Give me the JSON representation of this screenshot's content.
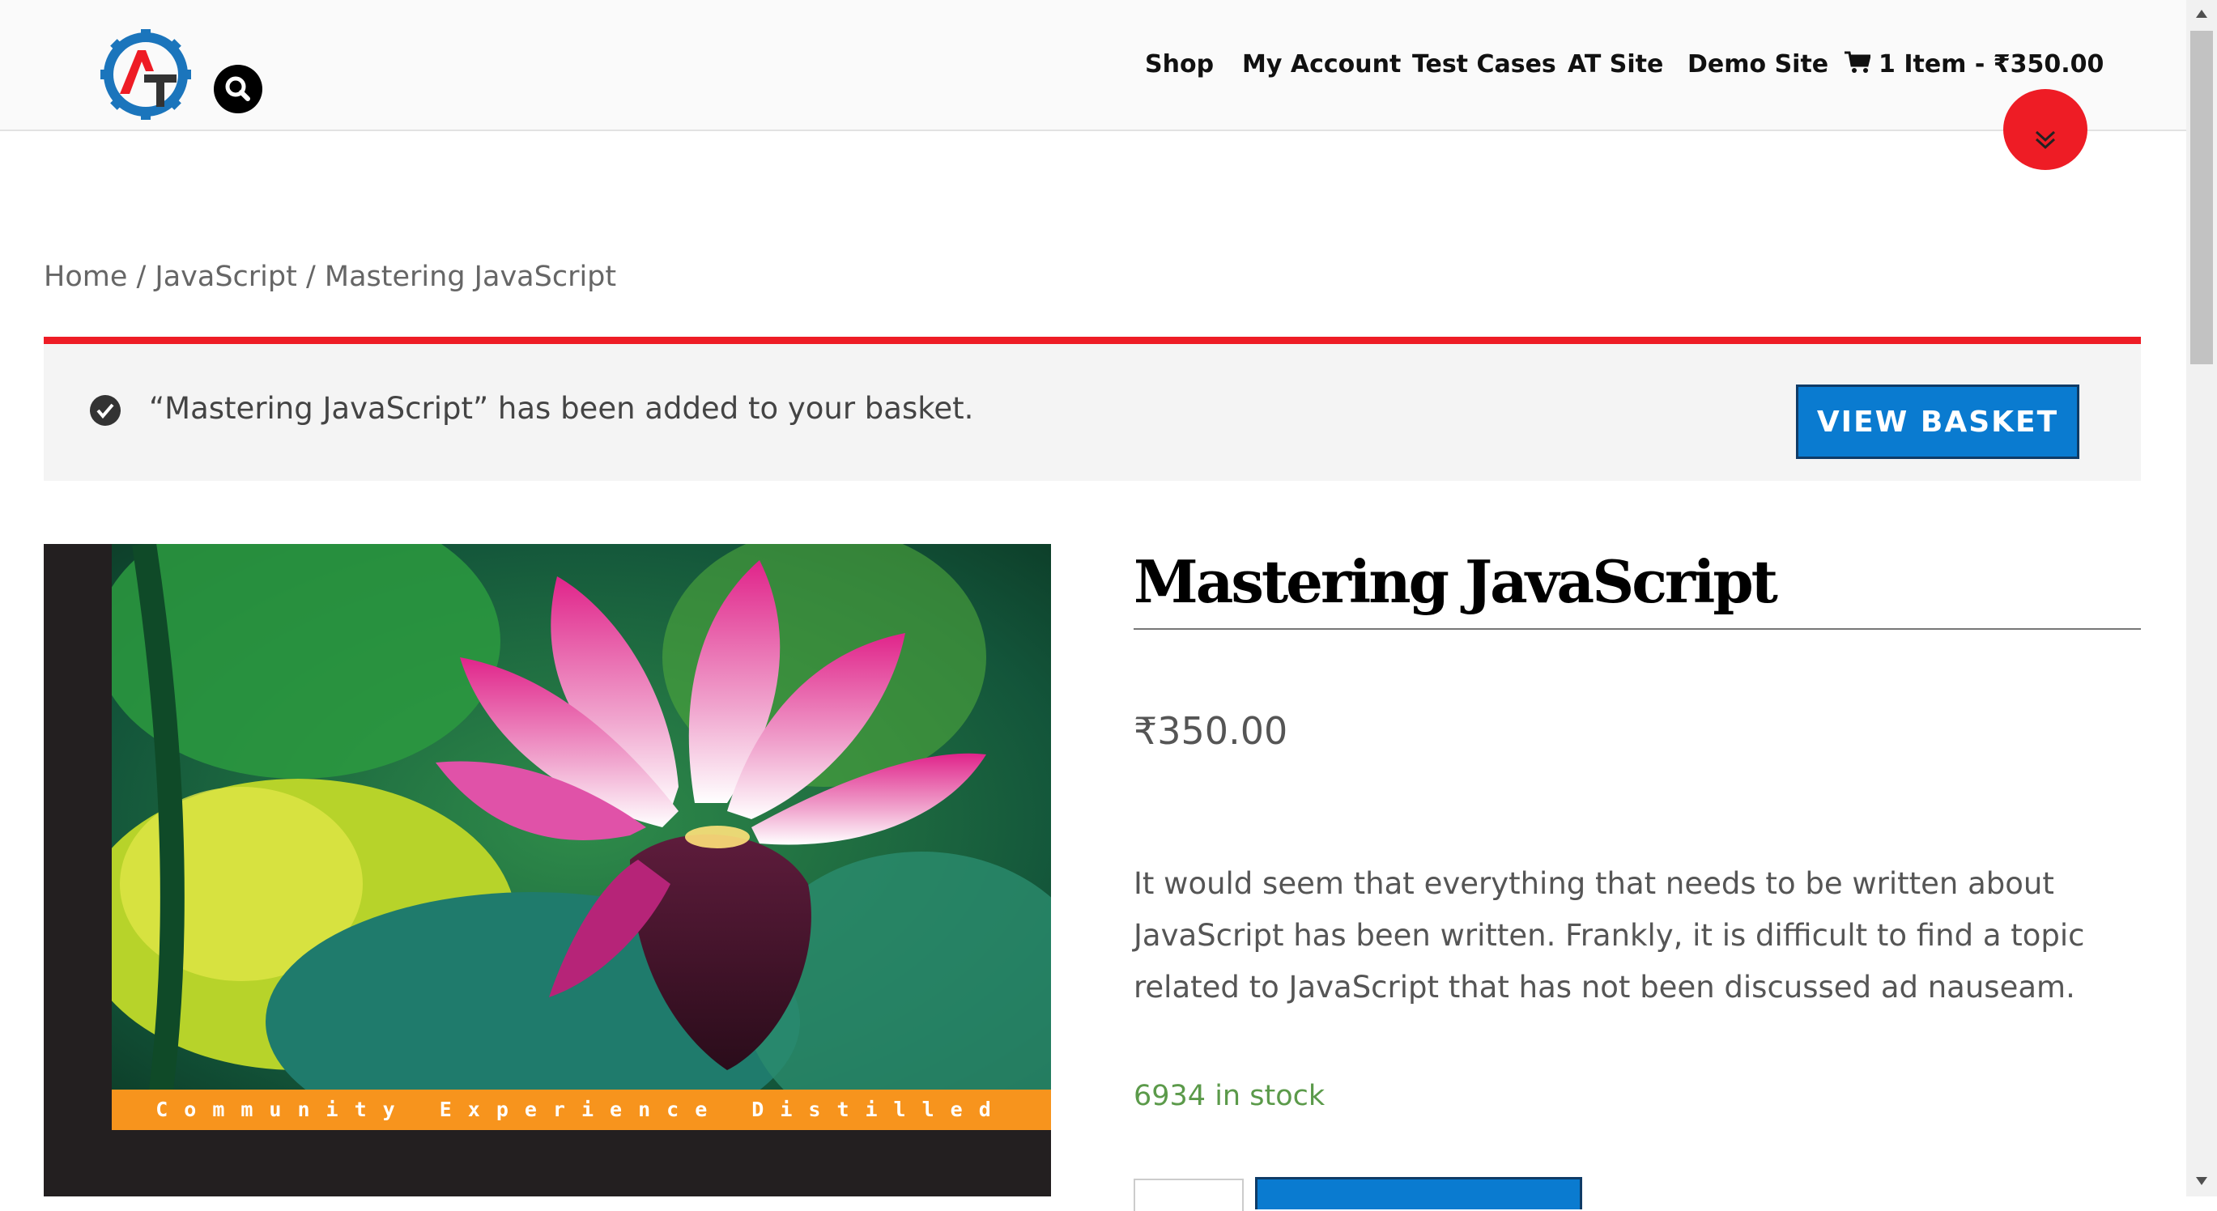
{
  "header": {
    "nav": {
      "shop": "Shop",
      "my_account": "My Account",
      "test_cases": "Test Cases",
      "at_site": "AT Site",
      "demo_site": "Demo Site",
      "cart": "1 Item - ₹350.00"
    },
    "icons": {
      "logo": "automation-testing-gear-logo",
      "search": "search-icon",
      "cart": "shopping-cart-icon",
      "down": "double-chevron-down-icon"
    }
  },
  "breadcrumb": {
    "home": "Home",
    "sep1": " / ",
    "category": "JavaScript",
    "sep2": " / ",
    "current": "Mastering JavaScript"
  },
  "notice": {
    "message": "“Mastering JavaScript” has been added to your basket.",
    "button": "VIEW BASKET",
    "icon": "check-circle-icon"
  },
  "product": {
    "cover_band_text": "Community Experience Distilled",
    "title": "Mastering JavaScript",
    "price": "₹350.00",
    "description": "It would seem that everything that needs to be written about JavaScript has been written. Frankly, it is difficult to find a topic related to JavaScript that has not been discussed ad nauseam.",
    "stock": "6934 in stock"
  },
  "colors": {
    "accent_red": "#ee1c25",
    "button_blue": "#0a7bd0",
    "stock_green": "#5b9a4a",
    "band_orange": "#f7941d"
  }
}
